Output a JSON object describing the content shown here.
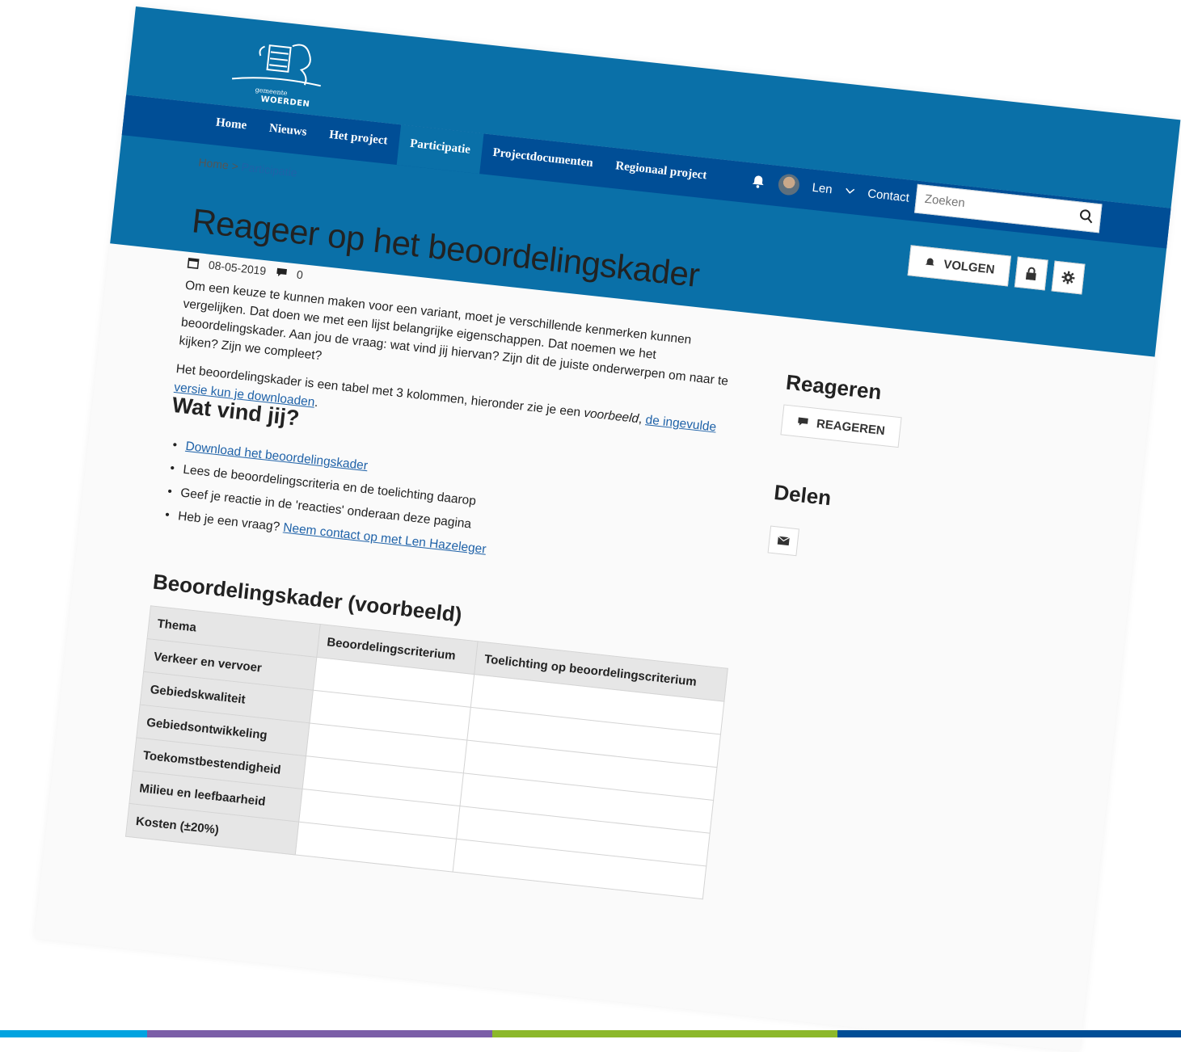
{
  "brand": {
    "small": "gemeente",
    "name": "WOERDEN"
  },
  "nav": {
    "items": [
      "Home",
      "Nieuws",
      "Het project",
      "Participatie",
      "Projectdocumenten",
      "Regionaal project"
    ],
    "active_index": 3
  },
  "userbar": {
    "user": "Len",
    "contact": "Contact"
  },
  "search": {
    "placeholder": "Zoeken"
  },
  "breadcrumb": {
    "home": "Home",
    "sep": ">",
    "current": "Participatie"
  },
  "actions": {
    "follow": "VOLGEN"
  },
  "page": {
    "title": "Reageer op het beoordelingskader",
    "date": "08-05-2019",
    "comments": "0",
    "p1": "Om een keuze te kunnen maken voor een variant, moet je verschillende kenmerken kunnen vergelijken. Dat doen we met een lijst belangrijke eigenschappen. Dat noemen we het beoordelingskader. Aan jou de vraag: wat vind jij hiervan? Zijn dit de juiste onderwerpen om naar te kijken? Zijn we compleet?",
    "p2_prefix": "Het beoordelingskader is een tabel met 3 kolommen, hieronder zie je een ",
    "p2_em": "voorbeeld",
    "p2_mid": ", ",
    "p2_link": "de ingevulde versie kun je downloaden",
    "p2_suffix": "."
  },
  "wat": {
    "heading": "Wat vind jij?",
    "li1_link": "Download het beoordelingskader",
    "li2": "Lees de beoordelingscriteria en de toelichting daarop",
    "li3": "Geef je reactie in de 'reacties' onderaan deze pagina",
    "li4_prefix": "Heb je een vraag? ",
    "li4_link": "Neem contact op met Len Hazeleger"
  },
  "table": {
    "heading": "Beoordelingskader (voorbeeld)",
    "headers": [
      "Thema",
      "Beoordelingscriterium",
      "Toelichting op beoordelingscriterium"
    ],
    "rows": [
      "Verkeer en vervoer",
      "Gebiedskwaliteit",
      "Gebiedsontwikkeling",
      "Toekomstbestendigheid",
      "Milieu en leefbaarheid",
      "Kosten (±20%)"
    ]
  },
  "sidebar": {
    "reageren_heading": "Reageren",
    "reageren_button": "REAGEREN",
    "delen_heading": "Delen"
  },
  "colors": {
    "header_light": "#0a70a8",
    "header_dark": "#004e96",
    "link": "#1f62a8",
    "footer": [
      "#00a3e0",
      "#7b5ea7",
      "#8cb82b",
      "#004e96"
    ]
  }
}
